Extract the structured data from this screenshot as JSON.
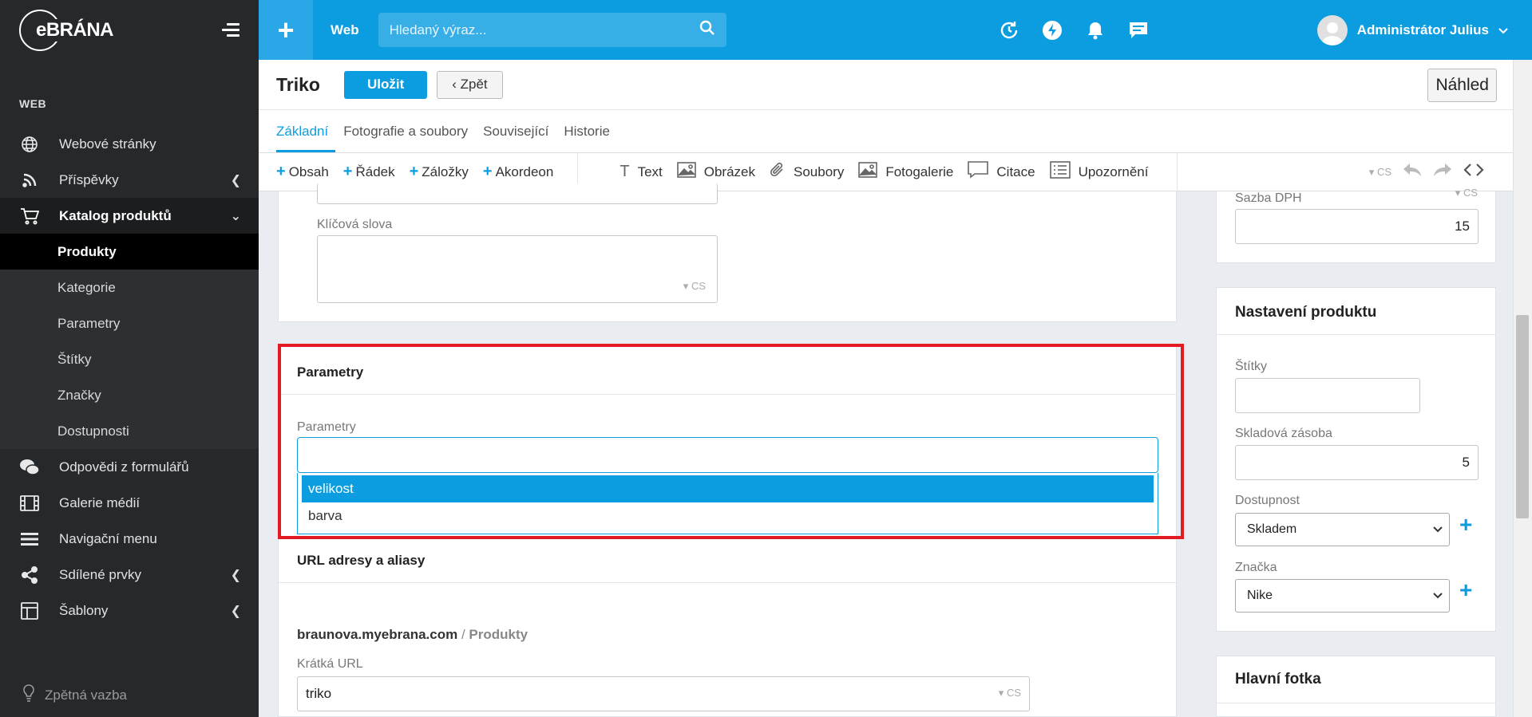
{
  "sidebar": {
    "logo": "eBRÁNA",
    "section_heading": "WEB",
    "items": [
      {
        "label": "Webové stránky",
        "icon": "globe-icon"
      },
      {
        "label": "Příspěvky",
        "icon": "rss-icon"
      },
      {
        "label": "Katalog produktů",
        "icon": "cart-icon"
      }
    ],
    "sub_items": [
      "Produkty",
      "Kategorie",
      "Parametry",
      "Štítky",
      "Značky",
      "Dostupnosti"
    ],
    "items_after": [
      {
        "label": "Odpovědi z formulářů",
        "icon": "chat-icon"
      },
      {
        "label": "Galerie médií",
        "icon": "film-icon"
      },
      {
        "label": "Navigační menu",
        "icon": "menu-icon"
      },
      {
        "label": "Sdílené prvky",
        "icon": "share-icon"
      },
      {
        "label": "Šablony",
        "icon": "template-icon"
      }
    ],
    "feedback": "Zpětná vazba"
  },
  "topbar": {
    "plus": "+",
    "web_label": "Web",
    "search_placeholder": "Hledaný výraz...",
    "user_name": "Administrátor Julius"
  },
  "header": {
    "title": "Triko",
    "save_label": "Uložit",
    "back_label": "‹ Zpět",
    "preview_label": "Náhled"
  },
  "tabs": [
    "Základní",
    "Fotografie a soubory",
    "Související",
    "Historie"
  ],
  "toolbar": {
    "add_items": [
      "Obsah",
      "Řádek",
      "Záložky",
      "Akordeon"
    ],
    "blocks": [
      "Text",
      "Obrázek",
      "Soubory",
      "Fotogalerie",
      "Citace",
      "Upozornění"
    ],
    "lang": "CS"
  },
  "main": {
    "keywords_label": "Klíčová slova",
    "keywords_lang": "CS",
    "params_heading": "Parametry",
    "params_label": "Parametry",
    "params_options": [
      "velikost",
      "barva"
    ],
    "url_heading": "URL adresy a aliasy",
    "domain": "braunova.myebrana.com",
    "path_sep": " / ",
    "path": "Produkty",
    "short_url_label": "Krátká URL",
    "short_url_value": "triko",
    "short_url_lang": "CS"
  },
  "right": {
    "vat_label": "Sazba DPH",
    "vat_value": "15",
    "vat_lang": "CS",
    "settings_heading": "Nastavení produktu",
    "tags_label": "Štítky",
    "stock_label": "Skladová zásoba",
    "stock_value": "5",
    "availability_label": "Dostupnost",
    "availability_value": "Skladem",
    "brand_label": "Značka",
    "brand_value": "Nike",
    "main_photo_heading": "Hlavní fotka"
  },
  "colors": {
    "accent": "#0c9de0",
    "sidebar": "#26292b",
    "highlight": "#e21b22"
  }
}
